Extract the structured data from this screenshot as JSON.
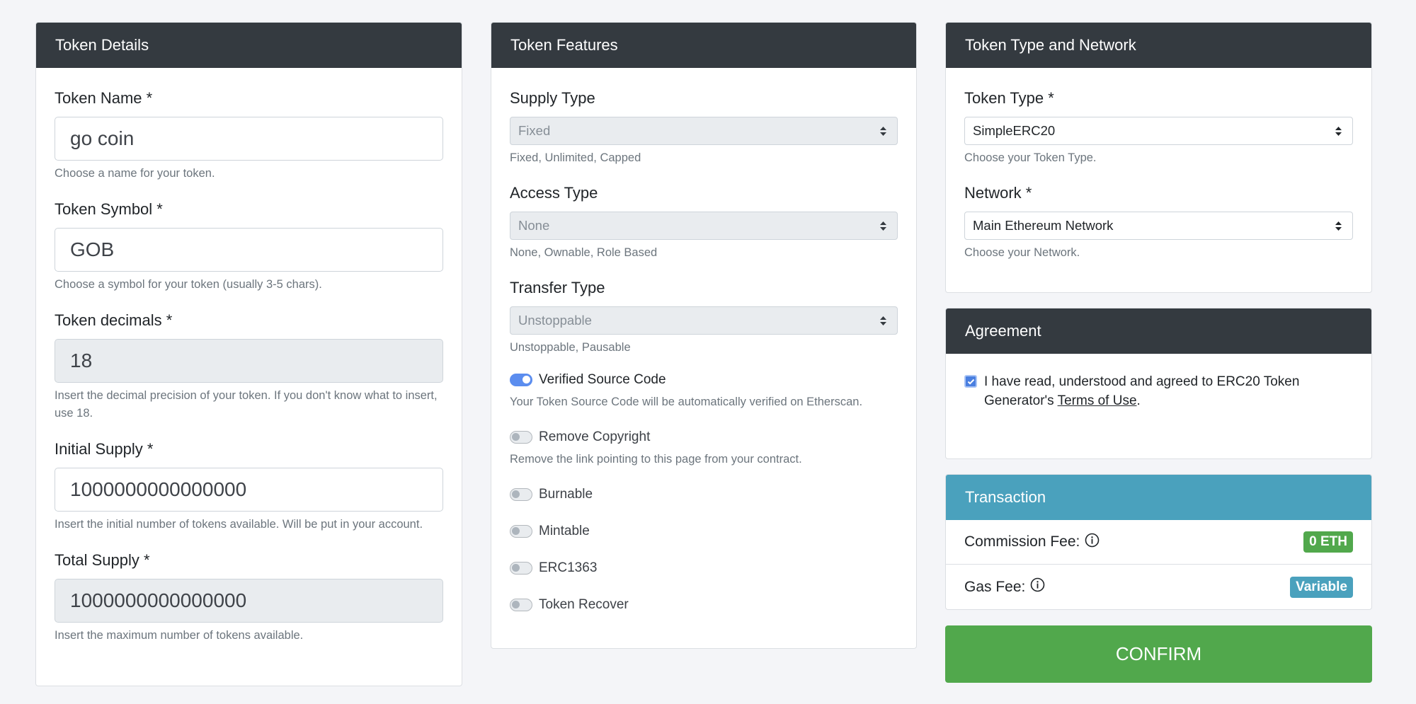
{
  "token_details": {
    "header": "Token Details",
    "name_label": "Token Name *",
    "name_value": "go coin",
    "name_help": "Choose a name for your token.",
    "symbol_label": "Token Symbol *",
    "symbol_value": "GOB",
    "symbol_help": "Choose a symbol for your token (usually 3-5 chars).",
    "decimals_label": "Token decimals *",
    "decimals_value": "18",
    "decimals_help": "Insert the decimal precision of your token. If you don't know what to insert, use 18.",
    "initial_label": "Initial Supply *",
    "initial_value": "1000000000000000",
    "initial_help": "Insert the initial number of tokens available. Will be put in your account.",
    "total_label": "Total Supply *",
    "total_value": "1000000000000000",
    "total_help": "Insert the maximum number of tokens available."
  },
  "token_features": {
    "header": "Token Features",
    "supply_label": "Supply Type",
    "supply_value": "Fixed",
    "supply_help": "Fixed, Unlimited, Capped",
    "access_label": "Access Type",
    "access_value": "None",
    "access_help": "None, Ownable, Role Based",
    "transfer_label": "Transfer Type",
    "transfer_value": "Unstoppable",
    "transfer_help": "Unstoppable, Pausable",
    "verified_label": "Verified Source Code",
    "verified_help": "Your Token Source Code will be automatically verified on Etherscan.",
    "copyright_label": "Remove Copyright",
    "copyright_help": "Remove the link pointing to this page from your contract.",
    "burnable_label": "Burnable",
    "mintable_label": "Mintable",
    "erc1363_label": "ERC1363",
    "recover_label": "Token Recover"
  },
  "token_type": {
    "header": "Token Type and Network",
    "type_label": "Token Type *",
    "type_value": "SimpleERC20",
    "type_help": "Choose your Token Type.",
    "network_label": "Network *",
    "network_value": "Main Ethereum Network",
    "network_help": "Choose your Network."
  },
  "agreement": {
    "header": "Agreement",
    "text_before": "I have read, understood and agreed to ERC20 Token Generator's ",
    "terms_link": "Terms of Use",
    "text_after": "."
  },
  "transaction": {
    "header": "Transaction",
    "commission_label": "Commission Fee:",
    "commission_value": "0 ETH",
    "gas_label": "Gas Fee:",
    "gas_value": "Variable"
  },
  "confirm_label": "CONFIRM",
  "colors": {
    "dark_header": "#343a40",
    "info_header": "#4aa1bd",
    "success": "#51a84c",
    "toggle_on": "#5b8def"
  },
  "icons": {
    "select_arrows": "up-down-caret-icon",
    "info": "info-circle-icon",
    "checkmark": "check-icon"
  }
}
